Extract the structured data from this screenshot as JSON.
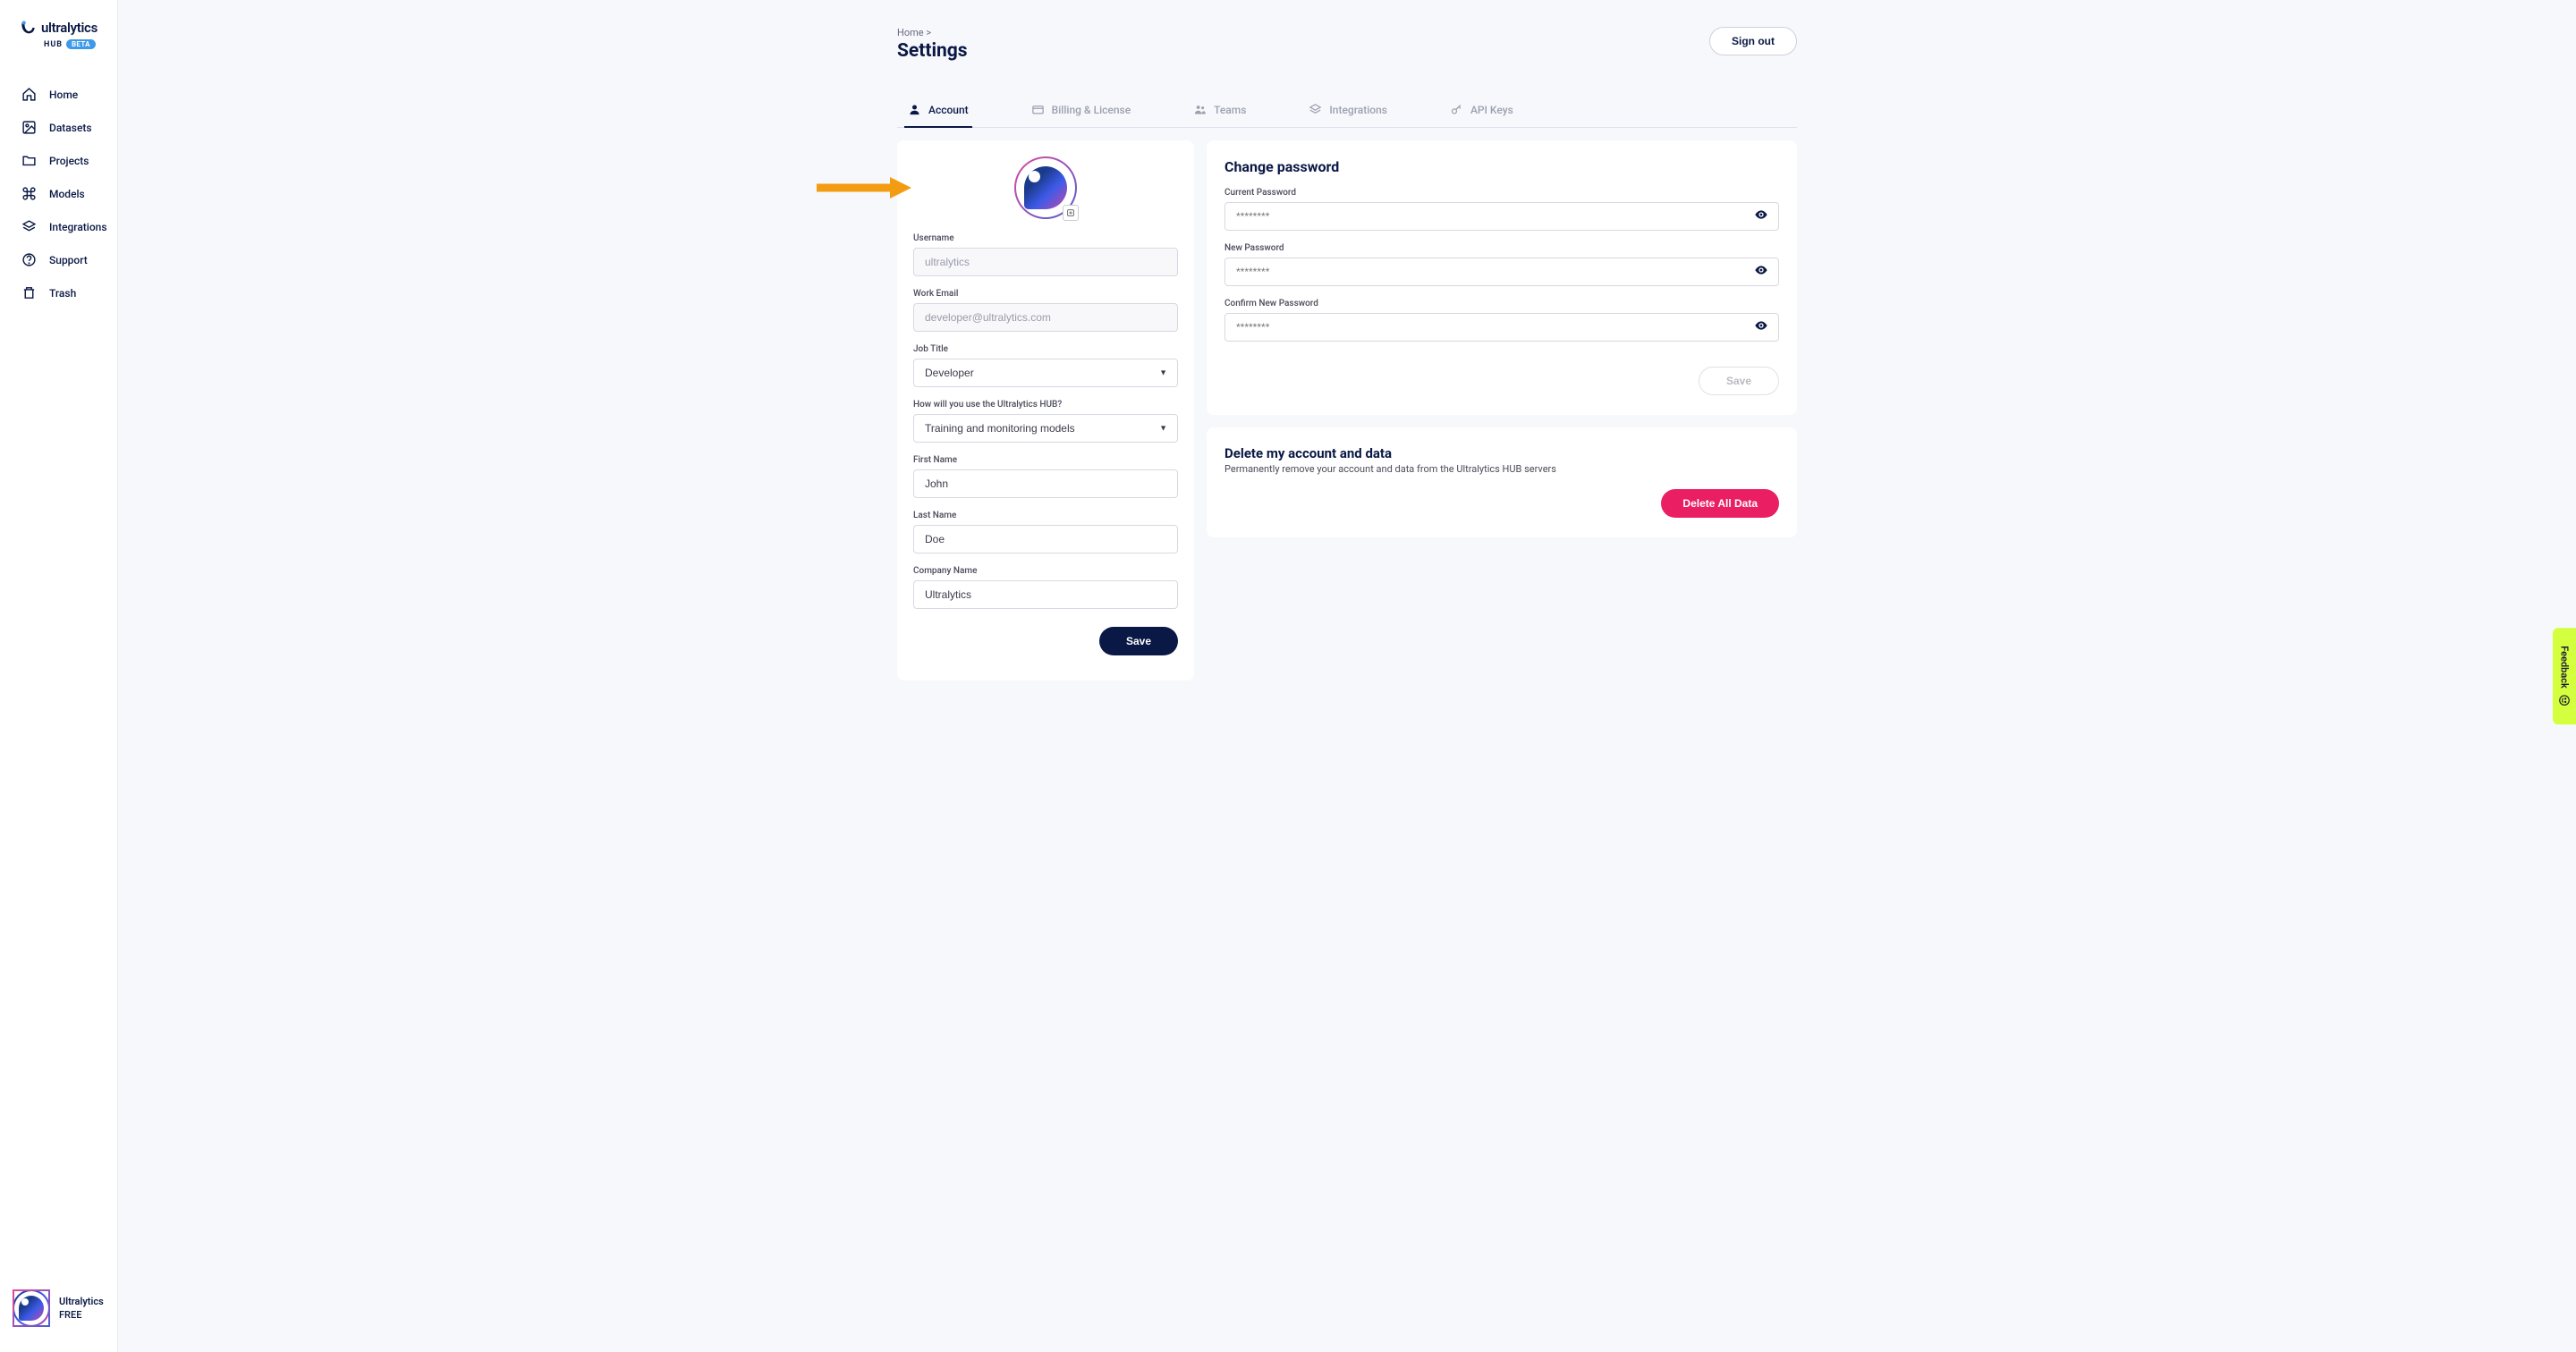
{
  "brand": {
    "name": "ultralytics",
    "sub": "HUB",
    "badge": "BETA"
  },
  "nav": {
    "items": [
      {
        "label": "Home"
      },
      {
        "label": "Datasets"
      },
      {
        "label": "Projects"
      },
      {
        "label": "Models"
      },
      {
        "label": "Integrations"
      },
      {
        "label": "Support"
      },
      {
        "label": "Trash"
      }
    ]
  },
  "user": {
    "name": "Ultralytics",
    "plan": "FREE"
  },
  "breadcrumb": {
    "home": "Home",
    "sep": ">"
  },
  "page": {
    "title": "Settings"
  },
  "actions": {
    "signout": "Sign out"
  },
  "tabs": [
    {
      "label": "Account",
      "active": true
    },
    {
      "label": "Billing & License",
      "active": false
    },
    {
      "label": "Teams",
      "active": false
    },
    {
      "label": "Integrations",
      "active": false
    },
    {
      "label": "API Keys",
      "active": false
    }
  ],
  "profile": {
    "username": {
      "label": "Username",
      "value": "ultralytics"
    },
    "email": {
      "label": "Work Email",
      "value": "developer@ultralytics.com"
    },
    "jobtitle": {
      "label": "Job Title",
      "value": "Developer"
    },
    "usage": {
      "label": "How will you use the Ultralytics HUB?",
      "value": "Training and monitoring models"
    },
    "firstname": {
      "label": "First Name",
      "value": "John"
    },
    "lastname": {
      "label": "Last Name",
      "value": "Doe"
    },
    "company": {
      "label": "Company Name",
      "value": "Ultralytics"
    },
    "save": "Save"
  },
  "password": {
    "title": "Change password",
    "current": {
      "label": "Current Password",
      "placeholder": "********"
    },
    "new": {
      "label": "New Password",
      "placeholder": "********"
    },
    "confirm": {
      "label": "Confirm New Password",
      "placeholder": "********"
    },
    "save": "Save"
  },
  "delete": {
    "title": "Delete my account and data",
    "sub": "Permanently remove your account and data from the Ultralytics HUB servers",
    "button": "Delete All Data"
  },
  "feedback": "Feedback"
}
